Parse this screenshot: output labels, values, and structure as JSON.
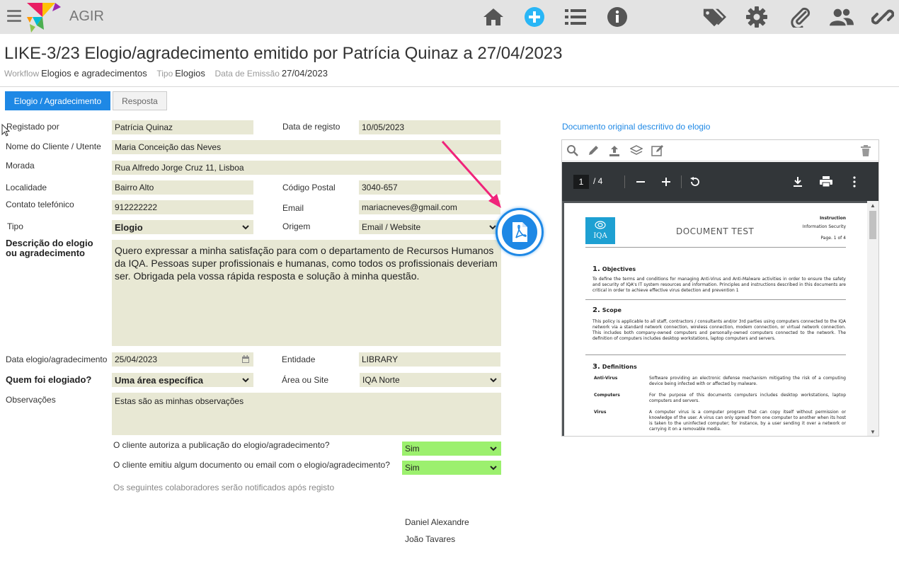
{
  "app": {
    "name": "AGIR",
    "colors": {
      "accent": "#1e88e5",
      "field_bg": "#e8e8d4",
      "field_green": "#9cf06e",
      "topbar_bg": "#e3e3e3"
    },
    "toolbar_icons": [
      "home-icon",
      "add-icon",
      "list-icon",
      "info-icon",
      "tags-icon",
      "gear-icon",
      "paperclip-icon",
      "users-icon",
      "link-icon"
    ]
  },
  "header": {
    "title": "LIKE-3/23 Elogio/agradecimento emitido por Patrícia Quinaz a 27/04/2023",
    "meta": [
      {
        "label": "Workflow",
        "value": "Elogios e agradecimentos"
      },
      {
        "label": "Tipo",
        "value": "Elogios"
      },
      {
        "label": "Data de Emissão",
        "value": "27/04/2023"
      }
    ]
  },
  "tabs": [
    {
      "label": "Elogio / Agradecimento",
      "active": true
    },
    {
      "label": "Resposta",
      "active": false
    }
  ],
  "form": {
    "registado_por": {
      "label": "Registado por",
      "value": "Patrícia Quinaz"
    },
    "data_registo": {
      "label": "Data de registo",
      "value": "10/05/2023"
    },
    "nome_cliente": {
      "label": "Nome do Cliente / Utente",
      "value": "Maria Conceição das Neves"
    },
    "morada": {
      "label": "Morada",
      "value": "Rua Alfredo Jorge Cruz 11, Lisboa"
    },
    "localidade": {
      "label": "Localidade",
      "value": "Bairro Alto"
    },
    "codigo_postal": {
      "label": "Código Postal",
      "value": "3040-657"
    },
    "contato": {
      "label": "Contato telefónico",
      "value": "912222222"
    },
    "email": {
      "label": "Email",
      "value": "mariacneves@gmail.com"
    },
    "tipo": {
      "label": "Tipo",
      "value": "Elogio"
    },
    "origem": {
      "label": "Origem",
      "value": "Email / Website"
    },
    "descricao": {
      "label_line1": "Descrição do elogio",
      "label_line2": "ou agradecimento",
      "value": "Quero expressar a minha satisfação para com o departamento de Recursos Humanos da IQA. Pessoas super profissionais e humanas, como todos os profissionais deveriam ser. Obrigada pela vossa rápida resposta e solução à minha questão."
    },
    "data_elogio": {
      "label": "Data elogio/agradecimento",
      "value": "25/04/2023"
    },
    "entidade": {
      "label": "Entidade",
      "value": "LIBRARY"
    },
    "quem_elogiado": {
      "label": "Quem foi elogiado?",
      "value": "Uma área específica"
    },
    "area_site": {
      "label": "Área ou Site",
      "value": "IQA Norte"
    },
    "observacoes": {
      "label": "Observações",
      "value": "Estas são as minhas observações"
    },
    "autoriza_publicacao": {
      "label": "O cliente autoriza a publicação do elogio/agradecimento?",
      "value": "Sim"
    },
    "emitiu_documento": {
      "label": "O cliente emitiu algum documento ou email com o elogio/agradecimento?",
      "value": "Sim"
    },
    "notice": "Os seguintes colaboradores serão notificados após registo",
    "notified": [
      "Daniel Alexandre",
      "João Tavares"
    ]
  },
  "document": {
    "panel_title": "Documento original descritivo do elogio",
    "viewer": {
      "current_page": "1",
      "page_total": "/ 4"
    },
    "page": {
      "logo_text": "IQA",
      "title": "DOCUMENT TEST",
      "right_line1": "Instruction",
      "right_line2": "Information Security",
      "right_line3": "Page. 1 of 4",
      "s1_num": "1.",
      "s1_title": "Objectives",
      "s1_text": "To define the terms and conditions for managing Anti-Virus and Anti-Malware activities in order to ensure the safety and security of IQA's IT system resources and information. Principles and instructions described in this documents are critical in order to achieve effective virus detection and prevention 1",
      "s2_num": "2.",
      "s2_title": "Scope",
      "s2_text": "This policy is applicable to all staff, contractors / consultants and/or 3rd parties using computers connected to the IQA network via a standard network connection, wireless connection, modem connection, or virtual network connection. This includes both company-owned computers and personally-owned computers connected to the network. The definition of computers includes desktop workstations, laptop computers and servers.",
      "s3_num": "3.",
      "s3_title": "Definitions",
      "defs": [
        {
          "term": "Anti-Virus",
          "desc": "Software providing an electronic defense mechanism mitigating the risk of a computing device being infected with or affected by malware."
        },
        {
          "term": "Computers",
          "desc": "For the purpose of this documents computers includes desktop workstations, laptop computers and servers."
        },
        {
          "term": "Virus",
          "desc": "A computer virus is a computer program that can copy itself without permission or knowledge of the user. A virus can only spread from one computer to another when its host is taken to the uninfected computer; for instance, by a user sending it over a network or carrying it on a removable media."
        }
      ]
    }
  }
}
